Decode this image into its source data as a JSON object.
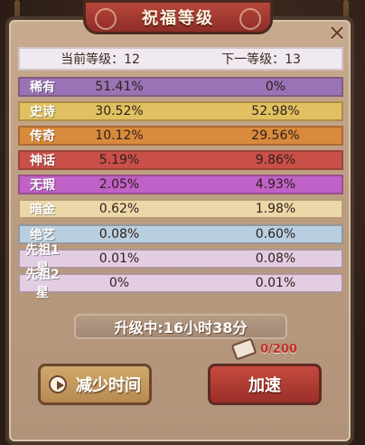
{
  "dialog": {
    "title": "祝福等级",
    "close_symbol": "×",
    "current_level_label": "当前等级：12",
    "next_level_label": "下一等级：13"
  },
  "rows": [
    {
      "name": "稀有",
      "current": "51.41%",
      "next": "0%",
      "color": "#9a73b6"
    },
    {
      "name": "史诗",
      "current": "30.52%",
      "next": "52.98%",
      "color": "#e0c060"
    },
    {
      "name": "传奇",
      "current": "10.12%",
      "next": "29.56%",
      "color": "#d98a3c"
    },
    {
      "name": "神话",
      "current": "5.19%",
      "next": "9.86%",
      "color": "#c85049"
    },
    {
      "name": "无瑕",
      "current": "2.05%",
      "next": "4.93%",
      "color": "#c061c8"
    },
    {
      "name": "暗金",
      "current": "0.62%",
      "next": "1.98%",
      "color": "#ecd7a8"
    },
    {
      "name": "绝艺",
      "current": "0.08%",
      "next": "0.60%",
      "color": "#b8cfe1"
    },
    {
      "name": "先祖1星",
      "current": "0.01%",
      "next": "0.08%",
      "color": "#e2cde2"
    },
    {
      "name": "先祖2星",
      "current": "0%",
      "next": "0.01%",
      "color": "#e2cde2"
    }
  ],
  "upgrade": {
    "text": "升级中:16小时38分"
  },
  "counter": {
    "text": "0/200"
  },
  "buttons": {
    "reduce": "减少时间",
    "speed": "加速"
  },
  "icons": {
    "close": "close-icon",
    "play": "play-icon",
    "ticket": "ticket-icon"
  }
}
